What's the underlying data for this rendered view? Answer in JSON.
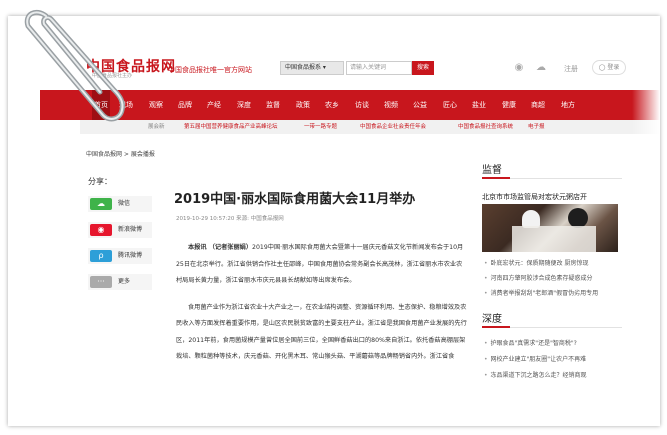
{
  "header": {
    "logo_text": "中国食品报网",
    "logo_subtext": "中国食品报社主办",
    "tagline": "中国食品报社唯一官方网站",
    "search_select": "中国食品报系 ▾",
    "search_placeholder": "请输入关键词",
    "search_button": "搜索",
    "weibo_icon": "weibo-icon",
    "wechat_icon": "wechat-icon",
    "register": "注册",
    "login": "登录"
  },
  "nav": {
    "items": [
      "首页",
      "现场",
      "观察",
      "品牌",
      "产经",
      "深度",
      "监督",
      "政策",
      "农乡",
      "访谈",
      "视频",
      "公益",
      "匠心",
      "盐业",
      "健康",
      "商超",
      "地方"
    ]
  },
  "subnav": {
    "items": [
      "展会新",
      "第五届中国营养健康食品产业高峰论坛",
      "一带一路专题",
      "中国食品企业社会责任年会",
      "中国食品报社查询系统",
      "电子报"
    ]
  },
  "breadcrumb": "中国食品报网 > 展会播报",
  "share": {
    "title": "分享：",
    "buttons": [
      {
        "label": "微信",
        "icon": "wechat-icon",
        "color": "#3fb34a"
      },
      {
        "label": "新浪微博",
        "icon": "weibo-icon",
        "color": "#e6162d"
      },
      {
        "label": "腾讯微博",
        "icon": "tencent-weibo-icon",
        "color": "#2d9fd8"
      },
      {
        "label": "更多",
        "icon": "more-icon",
        "color": "#aaaaaa"
      }
    ]
  },
  "article": {
    "title": "2019中国·丽水国际食用菌大会11月举办",
    "meta": "2019-10-29 10:57:20   来源: 中国食品报网",
    "lead_bold": "本报讯 （记者张丽娟）",
    "p1": "2019中国·丽水国际食用菌大会暨第十一届庆元香菇文化节新闻发布会于10月25日在北京举行。浙江省供销合作社主任邵峰，中国食用菌协会常务副会长高茂林，浙江省丽水市农业农村局局长黄力量，浙江省丽水市庆元县县长胡献如等出席发布会。",
    "p2": "食用菌产业作为浙江省农业十大产业之一，在农业结构调整、资源循环利用、生态保护、稳粮增效及农民收入等方面发挥着重要作用，是山区农民脱贫致富的主要支柱产业。浙江省是我国食用菌产业发展的先行区，2011年前，食用菌规模产量曾位居全国前三位，全国鲜香菇出口的80%来自浙江。依托香菇高棚层架栽培、颗粒菌种等技术，庆元香菇、开化黑木耳、常山猴头菇、平湖蘑菇等品牌畅销省内外。浙江省食"
  },
  "sidebar": {
    "supervision_title": "监督",
    "headline": "北京市市场监管局对宏状元粥店开",
    "supervision_items": [
      "卧底宏状元：保质期随便改 厨房惊现",
      "河南四方肇阿胶涉合成色素存疑惑成分",
      "消费者举报刮刮\"老郎酒\"假冒伪劣用专用"
    ],
    "depth_title": "深度",
    "depth_items": [
      "护眼食品\"真需求\"还是\"智商税\"?",
      "网校产业建立\"朋友圈\"让农户不再难",
      "冻品渠道下沉之路怎么走？经销商观"
    ]
  }
}
